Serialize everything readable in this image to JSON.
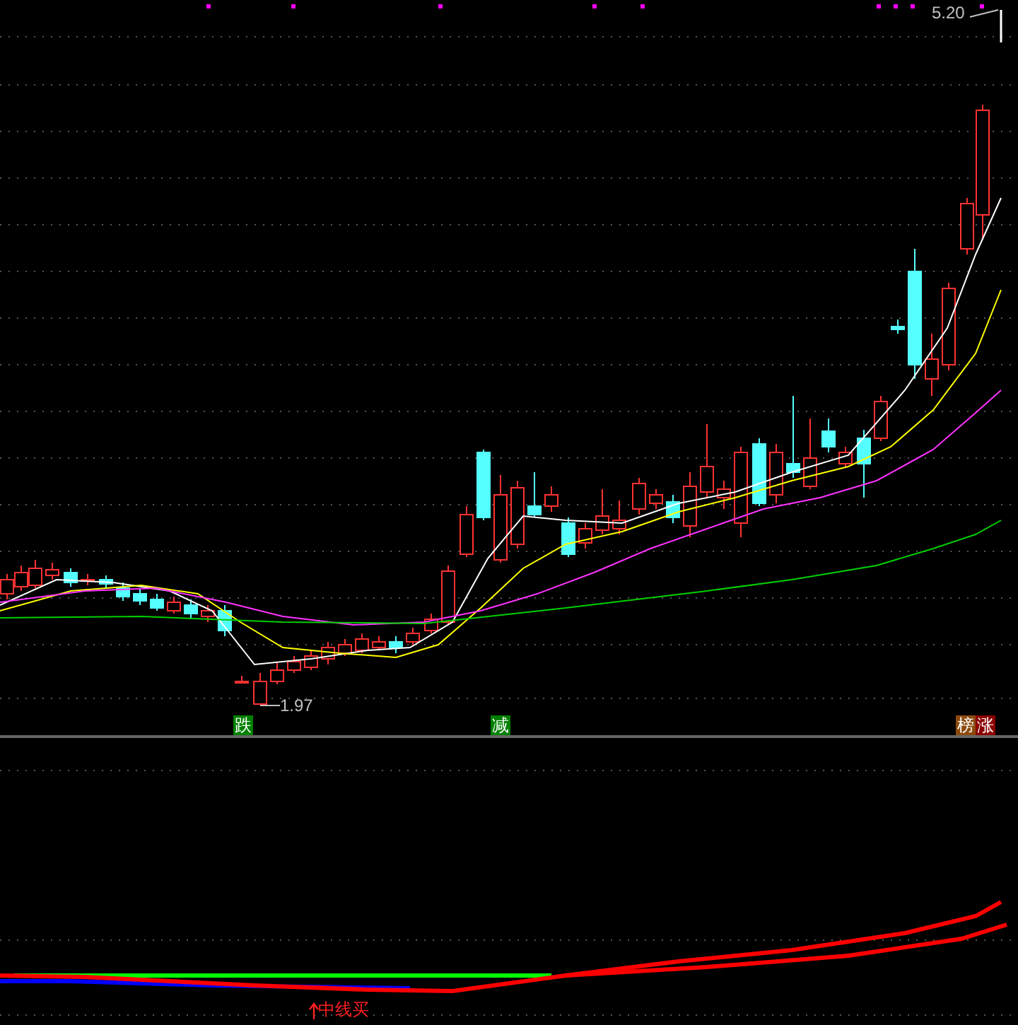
{
  "price_panel": {
    "high_label": "5.20",
    "low_label": "1.97",
    "signals": [
      {
        "text": "跌",
        "color": "#008000"
      },
      {
        "text": "减",
        "color": "#008000"
      }
    ],
    "badge": [
      {
        "text": "榜",
        "color": "#8b4a0c"
      },
      {
        "text": "涨",
        "color": "#8b0000"
      }
    ]
  },
  "indicator_panel": {
    "signal": "中线买"
  }
}
